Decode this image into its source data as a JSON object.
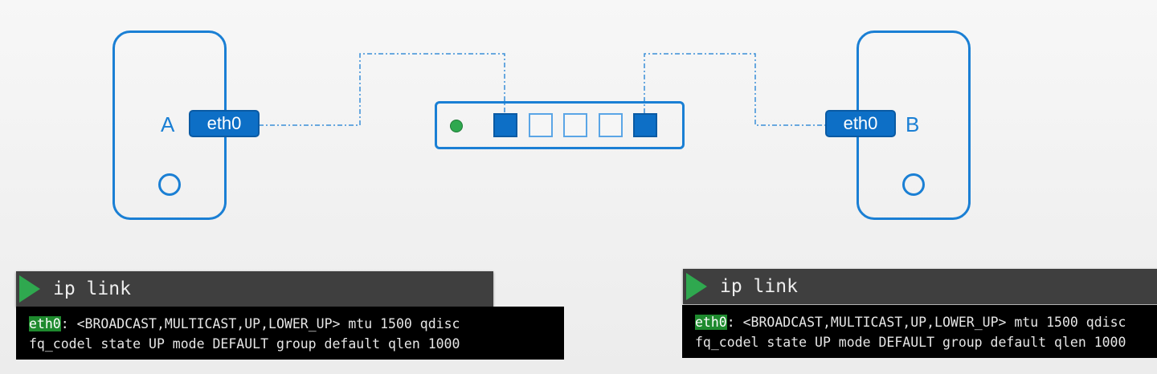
{
  "hosts": [
    {
      "name": "A",
      "interface": "eth0"
    },
    {
      "name": "B",
      "interface": "eth0"
    }
  ],
  "switch": {
    "ports": [
      "connected",
      "empty",
      "empty",
      "empty",
      "connected"
    ],
    "status_led_color": "#2fa84f"
  },
  "colors": {
    "accent": "#1a7fd4",
    "port_fill": "#0d6fc6"
  },
  "terminals": [
    {
      "command": "ip link",
      "iface": "eth0",
      "line1_rest": ": <BROADCAST,MULTICAST,UP,LOWER_UP> mtu 1500 qdisc",
      "line2": "fq_codel state UP mode DEFAULT group default qlen 1000"
    },
    {
      "command": "ip link",
      "iface": "eth0",
      "line1_rest": ": <BROADCAST,MULTICAST,UP,LOWER_UP> mtu 1500 qdisc",
      "line2": "fq_codel state UP mode DEFAULT group default qlen 1000"
    }
  ]
}
